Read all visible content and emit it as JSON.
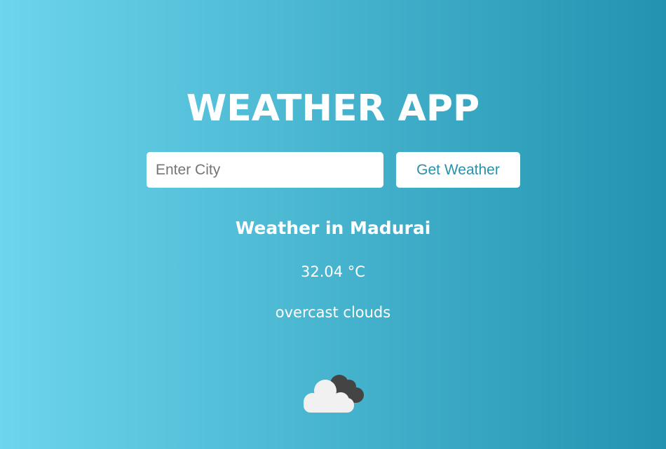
{
  "app": {
    "title": "WEATHER APP"
  },
  "search": {
    "placeholder": "Enter City",
    "value": "",
    "button_label": "Get Weather"
  },
  "result": {
    "heading": "Weather in Madurai",
    "temperature": "32.04 °C",
    "description": "overcast clouds",
    "icon": "overcast-clouds-icon"
  },
  "colors": {
    "gradient_start": "#6dd5ed",
    "gradient_end": "#2193b0",
    "text": "#ffffff",
    "button_text": "#2a8fab"
  }
}
